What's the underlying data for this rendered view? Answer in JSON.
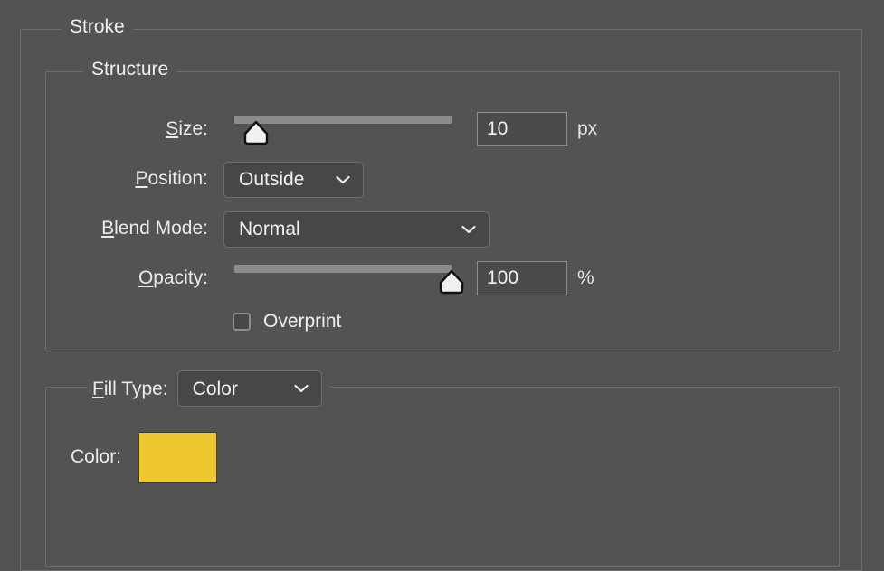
{
  "panel": {
    "title": "Stroke"
  },
  "structure": {
    "legend": "Structure",
    "size": {
      "label_mnemonic": "S",
      "label_rest": "ize:",
      "value": "10",
      "unit": "px",
      "slider_percent": 10
    },
    "position": {
      "label_mnemonic": "P",
      "label_rest": "osition:",
      "value": "Outside"
    },
    "blend_mode": {
      "label_mnemonic": "B",
      "label_rest": "lend Mode:",
      "value": "Normal"
    },
    "opacity": {
      "label_mnemonic": "O",
      "label_rest": "pacity:",
      "value": "100",
      "unit": "%",
      "slider_percent": 100
    },
    "overprint": {
      "label": "Overprint",
      "checked": false
    }
  },
  "fill_type": {
    "label_mnemonic": "F",
    "label_rest": "ill Type:",
    "value": "Color",
    "color": {
      "label": "Color:",
      "hex": "#efc72f"
    }
  },
  "theme": {
    "background": "#535353",
    "border": "#6d6d6d",
    "text": "#eaeaea",
    "track": "#8b8b8b",
    "field_bg": "#4b4b4b"
  }
}
